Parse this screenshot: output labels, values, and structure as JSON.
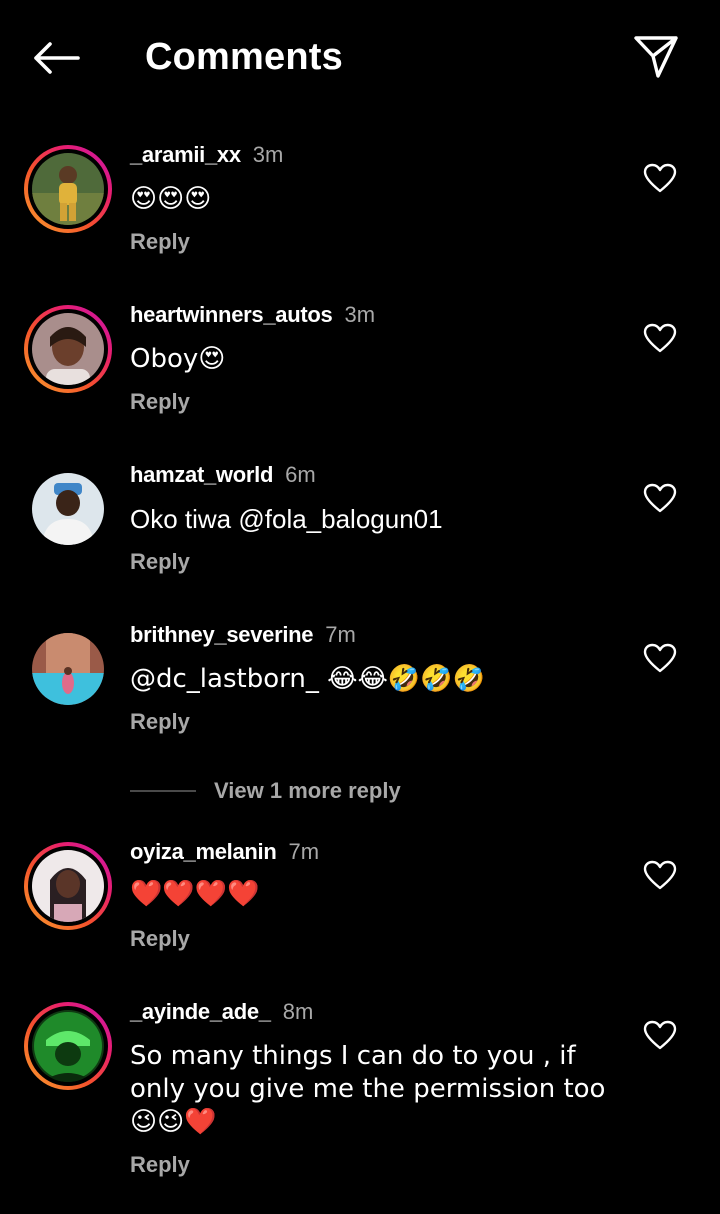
{
  "header": {
    "title": "Comments",
    "back_icon": "arrow-left-icon",
    "send_icon": "send-icon"
  },
  "colors": {
    "background": "#000000",
    "muted": "#a8a8a8",
    "story_ring": [
      "#f9a12f",
      "#f5532b",
      "#e91f6d",
      "#c213b5"
    ]
  },
  "comments": [
    {
      "username": "_aramii_xx",
      "time": "3m",
      "text": "😍😍😍",
      "reply_label": "Reply"
    },
    {
      "username": "heartwinners_autos",
      "time": "3m",
      "text": "Oboy😍",
      "reply_label": "Reply"
    },
    {
      "username": "hamzat_world",
      "time": "6m",
      "text": "Oko tiwa @fola_balogun01",
      "reply_label": "Reply"
    },
    {
      "username": "brithney_severine",
      "time": "7m",
      "text": "@dc_lastborn_ 😂😂🤣🤣🤣",
      "reply_label": "Reply"
    },
    {
      "username": "oyiza_melanin",
      "time": "7m",
      "text": "❤️❤️❤️❤️",
      "reply_label": "Reply"
    },
    {
      "username": "_ayinde_ade_",
      "time": "8m",
      "text": "So many things I can do to you , if only you give me the permission too 😉😉❤️",
      "reply_label": "Reply"
    }
  ],
  "view_more_label": "View 1 more reply"
}
